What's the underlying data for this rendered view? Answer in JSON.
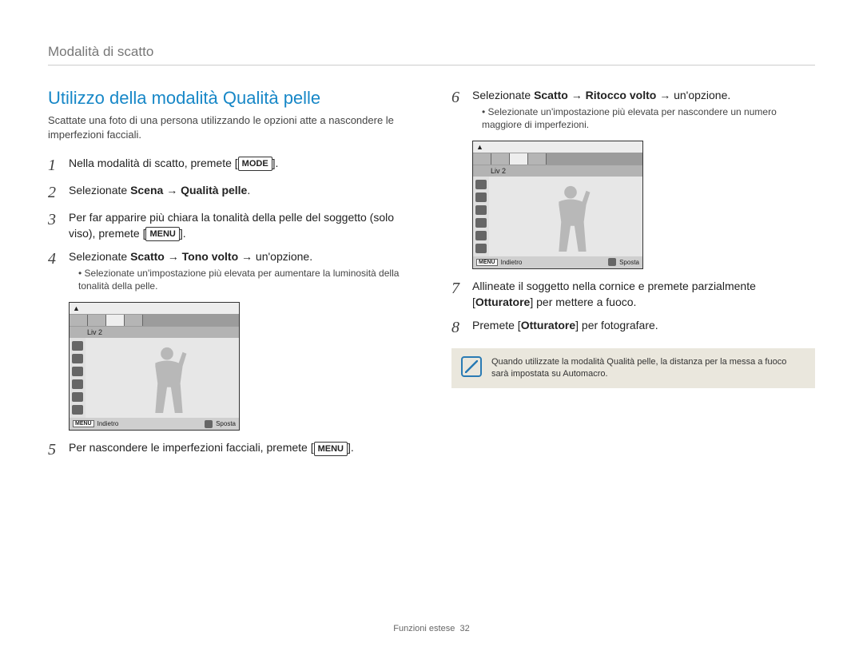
{
  "header": "Modalità di scatto",
  "left": {
    "title": "Utilizzo della modalità Qualità pelle",
    "intro": "Scattate una foto di una persona utilizzando le opzioni atte a nascondere le imperfezioni facciali.",
    "step1_pre": "Nella modalità di scatto, premete [",
    "step1_key": "MODE",
    "step1_post": "].",
    "step2_pre": "Selezionate ",
    "step2_bold1": "Scena",
    "step2_arrow": " → ",
    "step2_bold2": "Qualità pelle",
    "step2_post": ".",
    "step3_pre": "Per far apparire più chiara la tonalità della pelle del soggetto (solo viso), premete [",
    "step3_key": "MENU",
    "step3_post": "].",
    "step4_pre": "Selezionate ",
    "step4_bold1": "Scatto",
    "step4_arrow1": " → ",
    "step4_bold2": "Tono volto",
    "step4_arrow2": " → un'opzione.",
    "step4_bullet": "Selezionate un'impostazione più elevata per aumentare la luminosità della tonalità della pelle.",
    "step5_pre": "Per nascondere le imperfezioni facciali, premete [",
    "step5_key": "MENU",
    "step5_post": "]."
  },
  "right": {
    "step6_pre": "Selezionate ",
    "step6_bold1": "Scatto",
    "step6_arrow1": " → ",
    "step6_bold2": "Ritocco volto",
    "step6_arrow2": " → un'opzione.",
    "step6_bullet": "Selezionate un'impostazione più elevata per nascondere un numero maggiore di imperfezioni.",
    "step7_pre": "Allineate il soggetto nella cornice e premete parzialmente [",
    "step7_bold": "Otturatore",
    "step7_post": "] per mettere a fuoco.",
    "step8_pre": "Premete [",
    "step8_bold": "Otturatore",
    "step8_post": "] per fotografare.",
    "note_pre": "Quando utilizzate la modalità Qualità pelle, la distanza per la messa a fuoco sarà impostata su ",
    "note_bold": "Automacro",
    "note_post": "."
  },
  "lcd": {
    "liv": "Liv 2",
    "menu": "MENU",
    "back": "Indietro",
    "move": "Sposta"
  },
  "footer": {
    "label": "Funzioni estese",
    "page": "32"
  }
}
